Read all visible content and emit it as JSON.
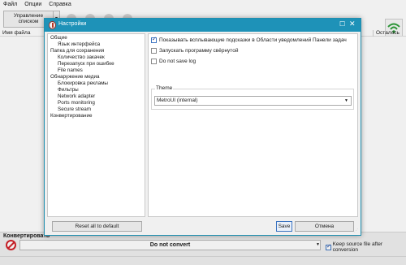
{
  "menu": {
    "items": [
      "Файл",
      "Опции",
      "Справка"
    ]
  },
  "toolbar": {
    "manage_button": "Управление списком"
  },
  "list": {
    "col_filename": "Имя файла",
    "col_remaining": "Осталось"
  },
  "convert_panel": {
    "title": "Конвертировать",
    "select_value": "Do not convert",
    "keep_source_label": "Keep source file after conversion",
    "keep_source_checked": true
  },
  "dialog": {
    "title": "Настройки",
    "tree": [
      {
        "label": "Общие",
        "level": 0
      },
      {
        "label": "Язык интерфейса",
        "level": 1
      },
      {
        "label": "Папка для сохранения",
        "level": 0
      },
      {
        "label": "Количество закачек",
        "level": 1
      },
      {
        "label": "Перезапуск при ошибке",
        "level": 1
      },
      {
        "label": "File names",
        "level": 1
      },
      {
        "label": "Обнаружение медиа",
        "level": 0
      },
      {
        "label": "Блокировка рекламы",
        "level": 1
      },
      {
        "label": "Фильтры",
        "level": 1
      },
      {
        "label": "Network adapter",
        "level": 1
      },
      {
        "label": "Ports monitoring",
        "level": 1
      },
      {
        "label": "Secure stream",
        "level": 1
      },
      {
        "label": "Конвертирование",
        "level": 0
      }
    ],
    "options": {
      "show_tips": {
        "label": "Показывать всплывающие подсказки в Области уведомлений Панели задач",
        "checked": true
      },
      "start_minimized": {
        "label": "Запускать программу свёрнутой",
        "checked": false
      },
      "no_log": {
        "label": "Do not save log",
        "checked": false
      }
    },
    "theme": {
      "label": "Theme",
      "value": "MetroUI (internal)"
    },
    "buttons": {
      "reset": "Reset all to default",
      "save": "Save",
      "cancel": "Отмена"
    }
  },
  "colors": {
    "title_bar": "#1e92b8",
    "accent": "#3b73c0",
    "no_convert": "#d2232a"
  }
}
